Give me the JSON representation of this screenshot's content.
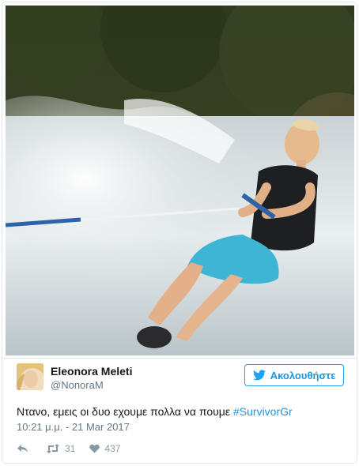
{
  "photo": {
    "description_icon": "photo-waterskier"
  },
  "author": {
    "name": "Eleonora Meleti",
    "handle": "@NonoraM"
  },
  "follow_button": {
    "label": "Ακολουθήστε",
    "icon": "twitter-bird-icon"
  },
  "tweet": {
    "text": "Ντανο, εμεις οι δυο εχουμε πολλα να πουμε ",
    "hashtag": "#SurvivorGr",
    "timestamp": "10:21 μ.μ. - 21 Mar 2017"
  },
  "actions": {
    "reply_icon": "reply-icon",
    "retweet_icon": "retweet-icon",
    "retweet_count": "31",
    "like_icon": "heart-icon",
    "like_count": "437"
  },
  "colors": {
    "accent": "#1da1f2",
    "link": "#1b95e0",
    "muted": "#657786",
    "icon": "#8899a6",
    "border": "#e1e8ed"
  }
}
